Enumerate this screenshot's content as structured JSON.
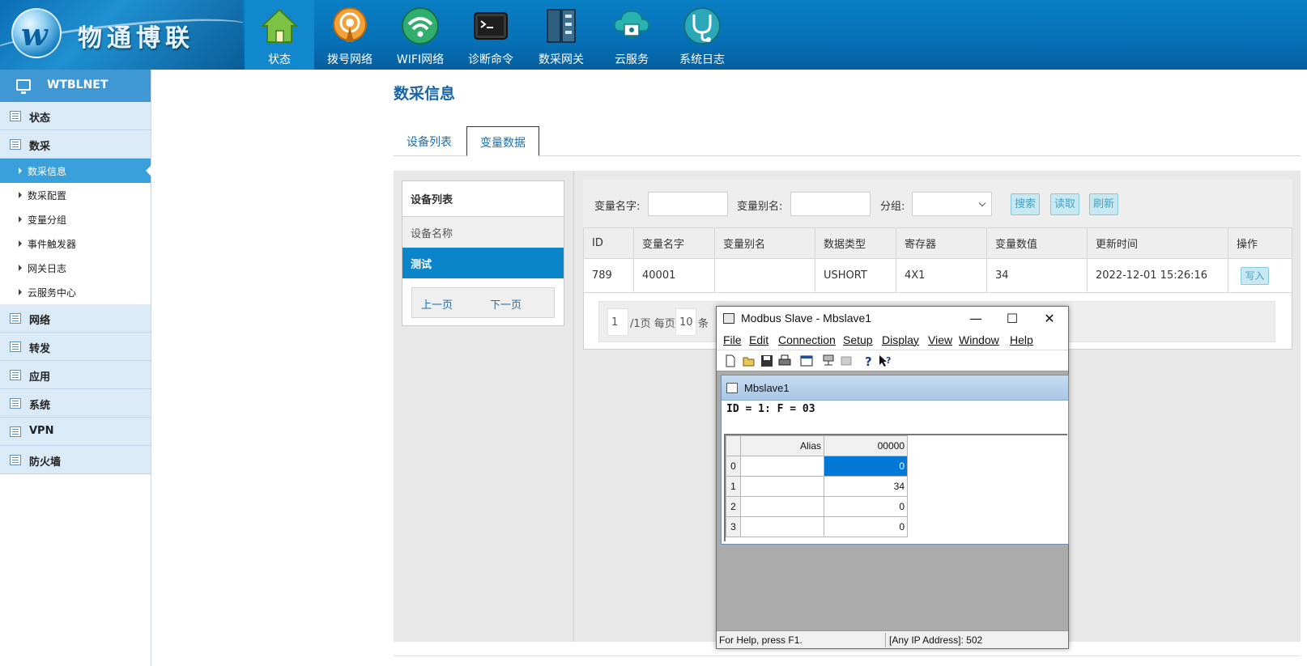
{
  "brand": {
    "name": "物通博联",
    "logo_letter": "w"
  },
  "colors": {
    "header_blue": "#0670b6",
    "active_blue": "#0b85c9",
    "link_blue": "#1a6fb5",
    "button_bg": "#c8e9f2"
  },
  "topnav": [
    {
      "label": "状态",
      "icon": "home-icon",
      "active": true
    },
    {
      "label": "拨号网络",
      "icon": "dial-network-icon"
    },
    {
      "label": "WIFI网络",
      "icon": "wifi-icon"
    },
    {
      "label": "诊断命令",
      "icon": "terminal-icon"
    },
    {
      "label": "数采网关",
      "icon": "gateway-icon"
    },
    {
      "label": "云服务",
      "icon": "cloud-icon"
    },
    {
      "label": "系统日志",
      "icon": "stethoscope-icon"
    }
  ],
  "sidebar": {
    "header": "WTBLNET",
    "groups": [
      {
        "label": "状态"
      },
      {
        "label": "数采"
      },
      {
        "label": "网络"
      },
      {
        "label": "转发"
      },
      {
        "label": "应用"
      },
      {
        "label": "系统"
      },
      {
        "label": "VPN"
      },
      {
        "label": "防火墙"
      }
    ],
    "subitems": [
      {
        "label": "数采信息",
        "active": true
      },
      {
        "label": "数采配置"
      },
      {
        "label": "变量分组"
      },
      {
        "label": "事件触发器"
      },
      {
        "label": "网关日志"
      },
      {
        "label": "云服务中心"
      }
    ]
  },
  "main": {
    "title": "数采信息",
    "tabs": [
      {
        "label": "设备列表"
      },
      {
        "label": "变量数据",
        "active": true
      }
    ],
    "device_list": {
      "header": "设备列表",
      "column": "设备名称",
      "rows": [
        "测试"
      ],
      "prev": "上一页",
      "next": "下一页"
    },
    "search": {
      "name_label": "变量名字:",
      "alias_label": "变量别名:",
      "group_label": "分组:",
      "search_btn": "搜索",
      "read_btn": "读取",
      "refresh_btn": "刷新"
    },
    "table": {
      "columns": [
        "ID",
        "变量名字",
        "变量别名",
        "数据类型",
        "寄存器",
        "变量数值",
        "更新时间",
        "操作"
      ],
      "rows": [
        {
          "id": "789",
          "name": "40001",
          "alias": "",
          "type": "USHORT",
          "register": "4X1",
          "value": "34",
          "time": "2022-12-01 15:26:16",
          "action": "写入"
        }
      ]
    },
    "pager": {
      "page": "1",
      "suffix": "/1页 每页",
      "per_page": "10",
      "unit": "条"
    }
  },
  "modbus": {
    "title": "Modbus Slave - Mbslave1",
    "menu": [
      "File",
      "Edit",
      "Connection",
      "Setup",
      "Display",
      "View",
      "Window",
      "Help"
    ],
    "child_title": "Mbslave1",
    "info": "ID = 1: F = 03",
    "grid_headers": {
      "alias": "Alias",
      "address": "00000"
    },
    "grid_rows": [
      {
        "row": "0",
        "alias": "",
        "value": "0",
        "selected": true
      },
      {
        "row": "1",
        "alias": "",
        "value": "34"
      },
      {
        "row": "2",
        "alias": "",
        "value": "0"
      },
      {
        "row": "3",
        "alias": "",
        "value": "0"
      }
    ],
    "status_left": "For Help, press F1.",
    "status_right": "[Any IP Address]: 502"
  }
}
